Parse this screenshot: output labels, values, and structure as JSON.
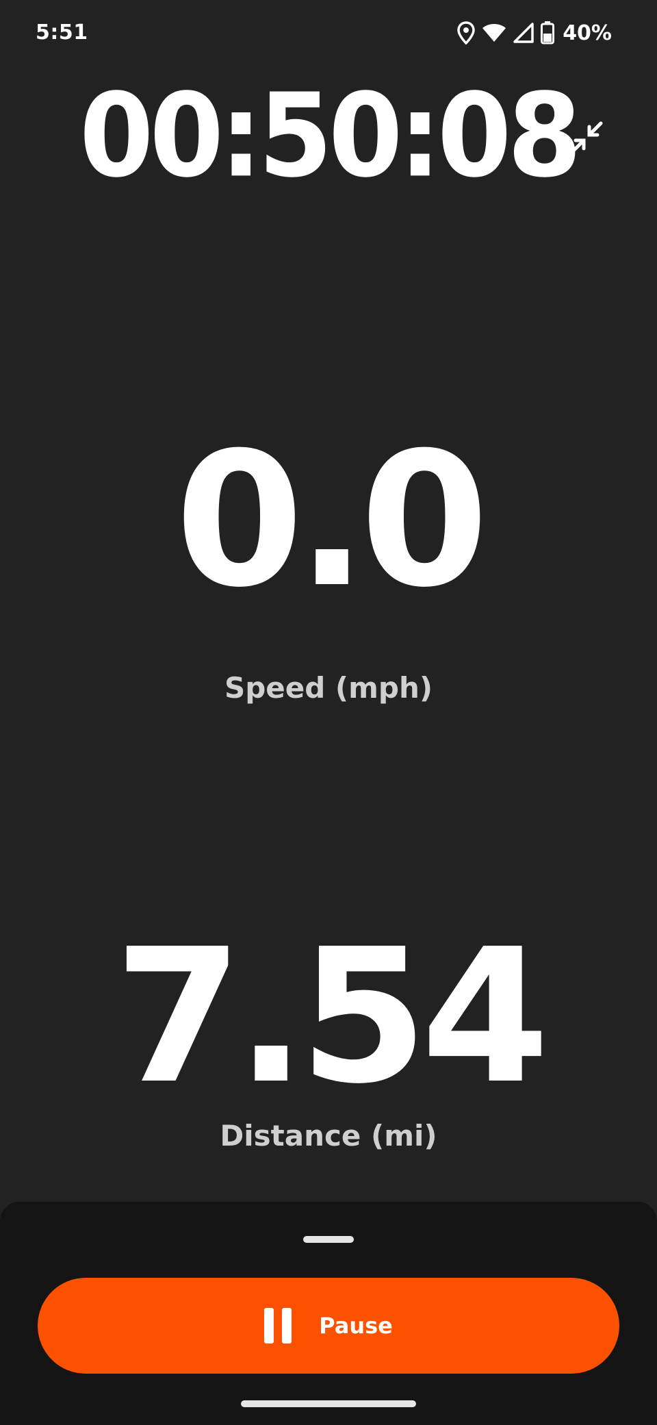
{
  "status_bar": {
    "time": "5:51",
    "battery_percent": "40%",
    "icons": [
      "location-icon",
      "wifi-icon",
      "cell-signal-icon",
      "battery-icon"
    ]
  },
  "timer": {
    "elapsed": "00:50:08",
    "collapse_icon": "collapse-arrows-icon"
  },
  "stats": {
    "speed": {
      "value": "0.0",
      "label": "Speed (mph)"
    },
    "distance": {
      "value": "7.54",
      "label": "Distance (mi)"
    }
  },
  "controls": {
    "pause_label": "Pause",
    "pause_icon": "pause-icon",
    "accent_color": "#fc5200"
  }
}
